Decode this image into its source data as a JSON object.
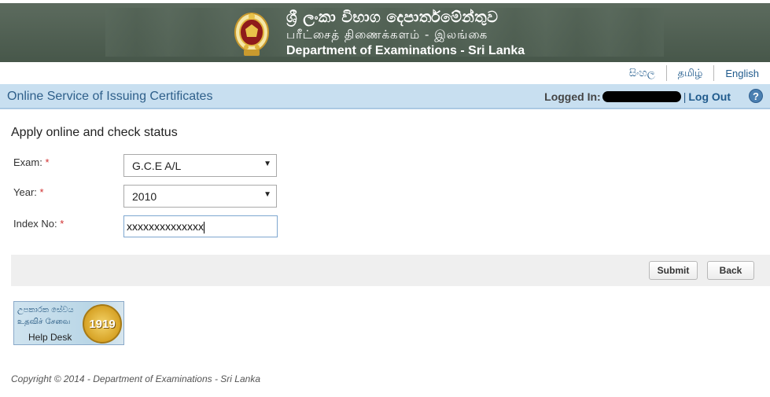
{
  "header": {
    "title_si": "ශ්‍රී ලංකා විභාග දෙපාර්තමේන්තුව",
    "title_ta": "பரீட்சைத் திணைக்களம் - இலங்கை",
    "title_en": "Department of Examinations - Sri Lanka",
    "emblem_icon": "sri-lanka-emblem-icon"
  },
  "languages": [
    {
      "label": "සිංහල"
    },
    {
      "label": "தமிழ்"
    },
    {
      "label": "English"
    }
  ],
  "nav": {
    "service_title": "Online Service of Issuing Certificates",
    "logged_in_label": "Logged In:",
    "separator": "|",
    "logout_label": "Log Out",
    "help_glyph": "?"
  },
  "form": {
    "heading": "Apply online and check status",
    "required_mark": "*",
    "exam": {
      "label": "Exam:",
      "value": "G.C.E A/L"
    },
    "year": {
      "label": "Year:",
      "value": "2010"
    },
    "index_no": {
      "label": "Index No:",
      "value": "xxxxxxxxxxxxxx"
    }
  },
  "actions": {
    "submit_label": "Submit",
    "back_label": "Back"
  },
  "helpdesk": {
    "line_si": "උපකාරක සේවය",
    "line_ta": "உதவிச் சேவை",
    "line_en": "Help Desk",
    "number": "1919"
  },
  "footer": {
    "copyright": "Copyright © 2014 - Department of Examinations - Sri Lanka"
  }
}
